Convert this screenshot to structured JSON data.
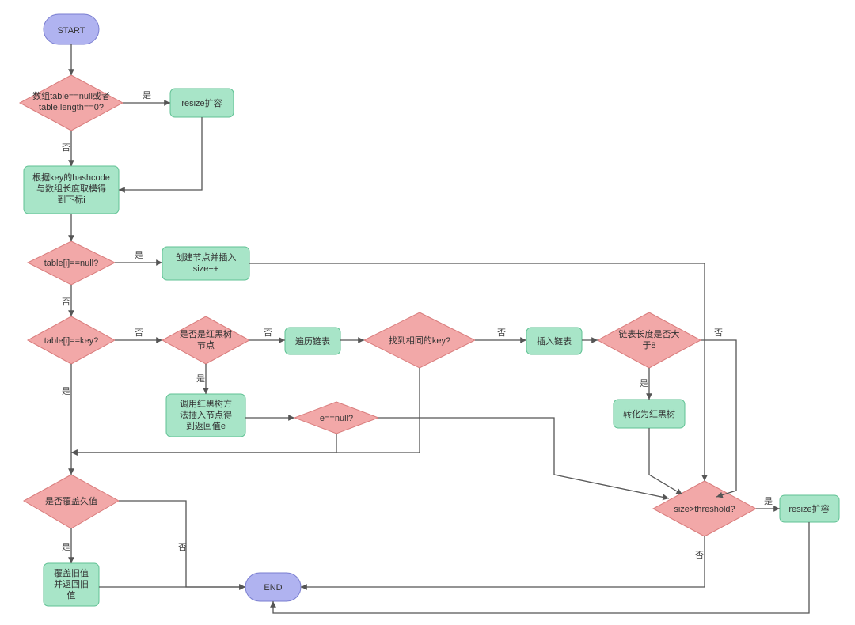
{
  "nodes": {
    "start": "START",
    "d1": "数组table==null或者\ntable.length==0?",
    "p1": "resize扩容",
    "p2": "根据key的hashcode\n与数组长度取模得\n到下标i",
    "d2": "table[i]==null?",
    "p3": "创建节点并插入\nsize++",
    "d3": "table[i]==key?",
    "d4": "是否是红黑树\n节点",
    "p4": "遍历链表",
    "d5": "找到相同的key?",
    "p5": "插入链表",
    "d6": "链表长度是否大\n于8",
    "p6": "调用红黑树方\n法插入节点得\n到返回值e",
    "d7": "e==null?",
    "p7": "转化为红黑树",
    "d8": "是否覆盖久值",
    "d9": "size>threshold?",
    "p8": "resize扩容",
    "p9": "覆盖旧值\n并返回旧\n值",
    "end": "END"
  },
  "labels": {
    "yes": "是",
    "no": "否"
  }
}
